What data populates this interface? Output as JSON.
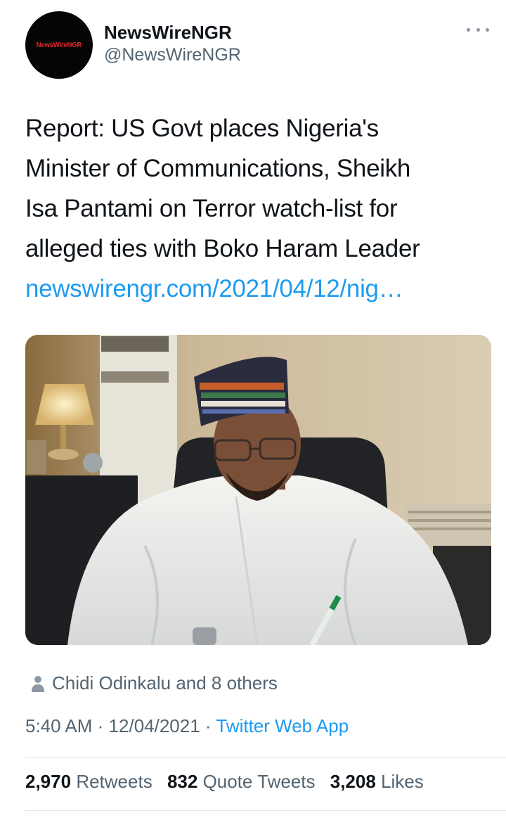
{
  "author": {
    "display_name": "NewsWireNGR",
    "handle": "@NewsWireNGR",
    "avatar_text": "NewsWireNGR"
  },
  "tweet": {
    "text_lines": [
      "Report: US Govt places Nigeria's",
      "Minister of Communications, Sheikh",
      "Isa Pantami on Terror watch-list for",
      "alleged ties with Boko Haram Leader"
    ],
    "link": "newswirengr.com/2021/04/12/nig…"
  },
  "liked_by": "Chidi Odinkalu and 8 others",
  "meta": {
    "time": "5:40 AM",
    "date": "12/04/2021",
    "separator": "·",
    "source": "Twitter Web App"
  },
  "stats": {
    "retweets_count": "2,970",
    "retweets_label": "Retweets",
    "quotes_count": "832",
    "quotes_label": "Quote Tweets",
    "likes_count": "3,208",
    "likes_label": "Likes"
  },
  "colors": {
    "link": "#1d9bf0",
    "secondary": "#536471",
    "primary": "#0f1419",
    "avatar_bg": "#050505",
    "avatar_text": "#e0262a"
  },
  "icons": {
    "more": "more-horizontal-icon",
    "person": "person-icon"
  }
}
